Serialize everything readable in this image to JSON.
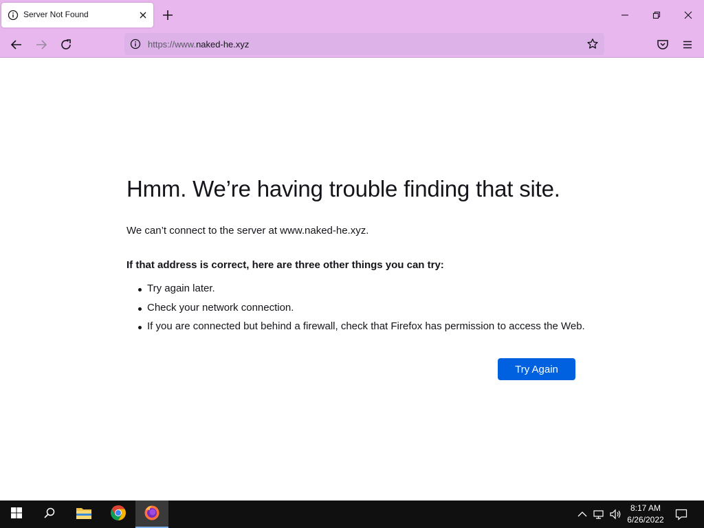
{
  "browser": {
    "tab": {
      "title": "Server Not Found",
      "icon": "info-icon"
    },
    "url": {
      "prefix": "https://www.",
      "domain": "naked-he.xyz"
    }
  },
  "error": {
    "title": "Hmm. We’re having trouble finding that site.",
    "description": "We can’t connect to the server at www.naked-he.xyz.",
    "suggestions_heading": "If that address is correct, here are three other things you can try:",
    "suggestions": [
      "Try again later.",
      "Check your network connection.",
      "If you are connected but behind a firewall, check that Firefox has permission to access the Web."
    ],
    "button_label": "Try Again",
    "button_color": "#0061e0"
  },
  "taskbar": {
    "pinned": [
      "start-icon",
      "search-icon",
      "file-explorer-icon",
      "chrome-icon",
      "firefox-icon"
    ],
    "clock": {
      "time": "8:17 AM",
      "date": "6/26/2022"
    }
  },
  "colors": {
    "toolbar": "#e8b7ee",
    "urlbar": "#ddb2e8",
    "taskbar": "#101010"
  }
}
